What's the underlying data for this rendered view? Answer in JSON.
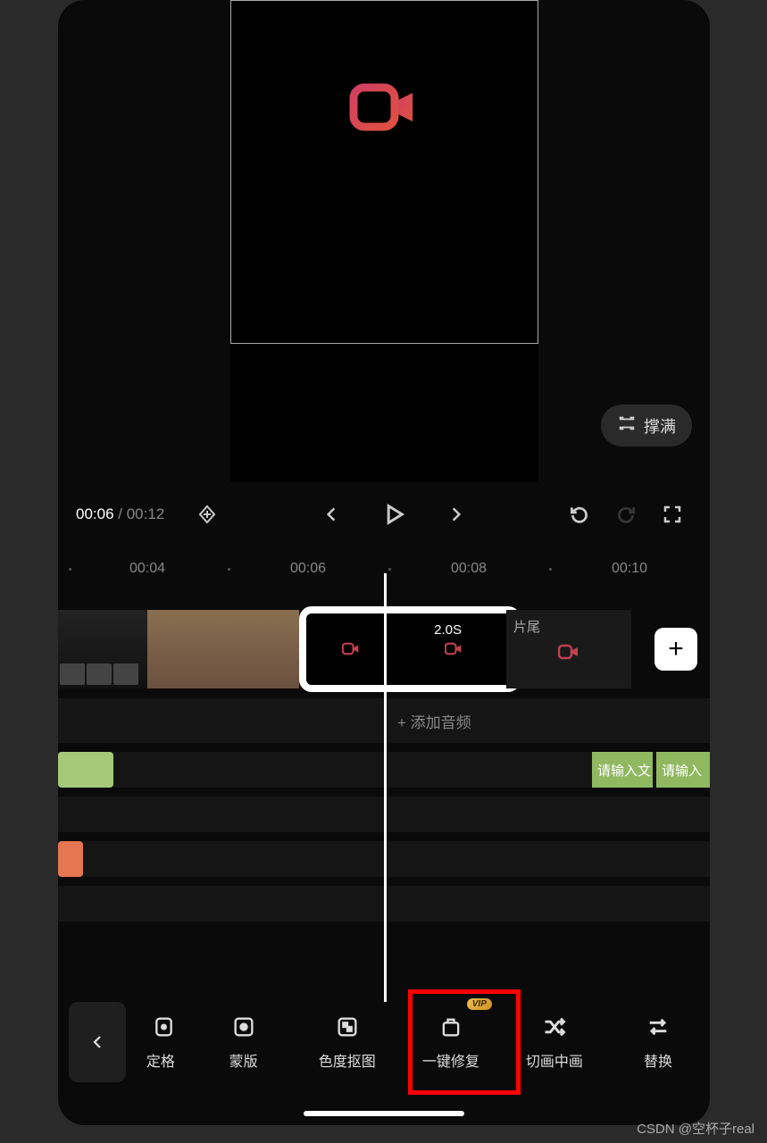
{
  "preview": {
    "fill_label": "撑满"
  },
  "playback": {
    "current": "00:06",
    "sep": " / ",
    "total": "00:12"
  },
  "ruler": {
    "t1": "00:04",
    "t2": "00:06",
    "t3": "00:08",
    "t4": "00:10"
  },
  "clips": {
    "selected_duration": "2.0S",
    "end_label": "片尾"
  },
  "tracks": {
    "add_audio": "+  添加音频",
    "text1": "请输入文",
    "text2": "请输入"
  },
  "tools": {
    "back": "‹",
    "t0": "定格",
    "t1": "蒙版",
    "t2": "色度抠图",
    "t3": "一键修复",
    "t4": "切画中画",
    "t5": "替换",
    "vip": "VIP"
  },
  "watermark": "CSDN @空杯子real"
}
